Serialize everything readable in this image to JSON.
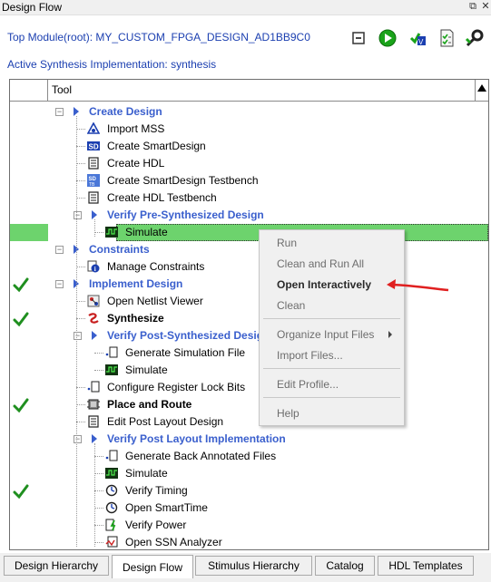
{
  "window": {
    "title": "Design Flow",
    "buttons": [
      "restore-icon",
      "close-icon"
    ]
  },
  "header": {
    "top_module": "Top Module(root): MY_CUSTOM_FPGA_DESIGN_AD1BB9C0",
    "active_synthesis": "Active Synthesis Implementation: synthesis",
    "toolbar_icons": [
      "collapse-all-icon",
      "run-icon",
      "check-hdl-icon",
      "report-icon",
      "settings-icon"
    ]
  },
  "tree": {
    "columns": [
      "",
      "Tool"
    ],
    "rows": [
      {
        "label": "Create Design",
        "style": "group"
      },
      {
        "label": "Import MSS"
      },
      {
        "label": "Create SmartDesign"
      },
      {
        "label": "Create HDL"
      },
      {
        "label": "Create SmartDesign Testbench"
      },
      {
        "label": "Create HDL Testbench"
      },
      {
        "label": "Verify Pre-Synthesized Design",
        "style": "group"
      },
      {
        "label": "Simulate",
        "selected": true
      },
      {
        "label": "Constraints",
        "style": "group"
      },
      {
        "label": "Manage Constraints"
      },
      {
        "label": "Implement Design",
        "style": "group",
        "checked": true
      },
      {
        "label": "Open Netlist Viewer"
      },
      {
        "label": "Synthesize",
        "style": "bold",
        "checked": true
      },
      {
        "label": "Verify Post-Synthesized Design",
        "style": "group"
      },
      {
        "label": "Generate Simulation File"
      },
      {
        "label": "Simulate"
      },
      {
        "label": "Configure Register Lock Bits"
      },
      {
        "label": "Place and Route",
        "style": "bold",
        "checked": true
      },
      {
        "label": "Edit Post Layout Design"
      },
      {
        "label": "Verify Post Layout Implementation",
        "style": "group"
      },
      {
        "label": "Generate Back Annotated Files"
      },
      {
        "label": "Simulate"
      },
      {
        "label": "Verify Timing",
        "checked": true
      },
      {
        "label": "Open SmartTime"
      },
      {
        "label": "Verify Power"
      },
      {
        "label": "Open SSN Analyzer"
      }
    ]
  },
  "context_menu": {
    "items": [
      {
        "label": "Run"
      },
      {
        "label": "Clean and Run All"
      },
      {
        "label": "Open Interactively",
        "strong": true
      },
      {
        "label": "Clean"
      },
      {
        "label": "Organize Input Files",
        "submenu": true
      },
      {
        "label": "Import Files..."
      },
      {
        "label": "Edit Profile..."
      },
      {
        "label": "Help"
      }
    ]
  },
  "annotation": {
    "color": "#e02020"
  },
  "tabs": {
    "items": [
      "Design Hierarchy",
      "Design Flow",
      "Stimulus Hierarchy",
      "Catalog",
      "HDL Templates"
    ],
    "active": "Design Flow"
  }
}
